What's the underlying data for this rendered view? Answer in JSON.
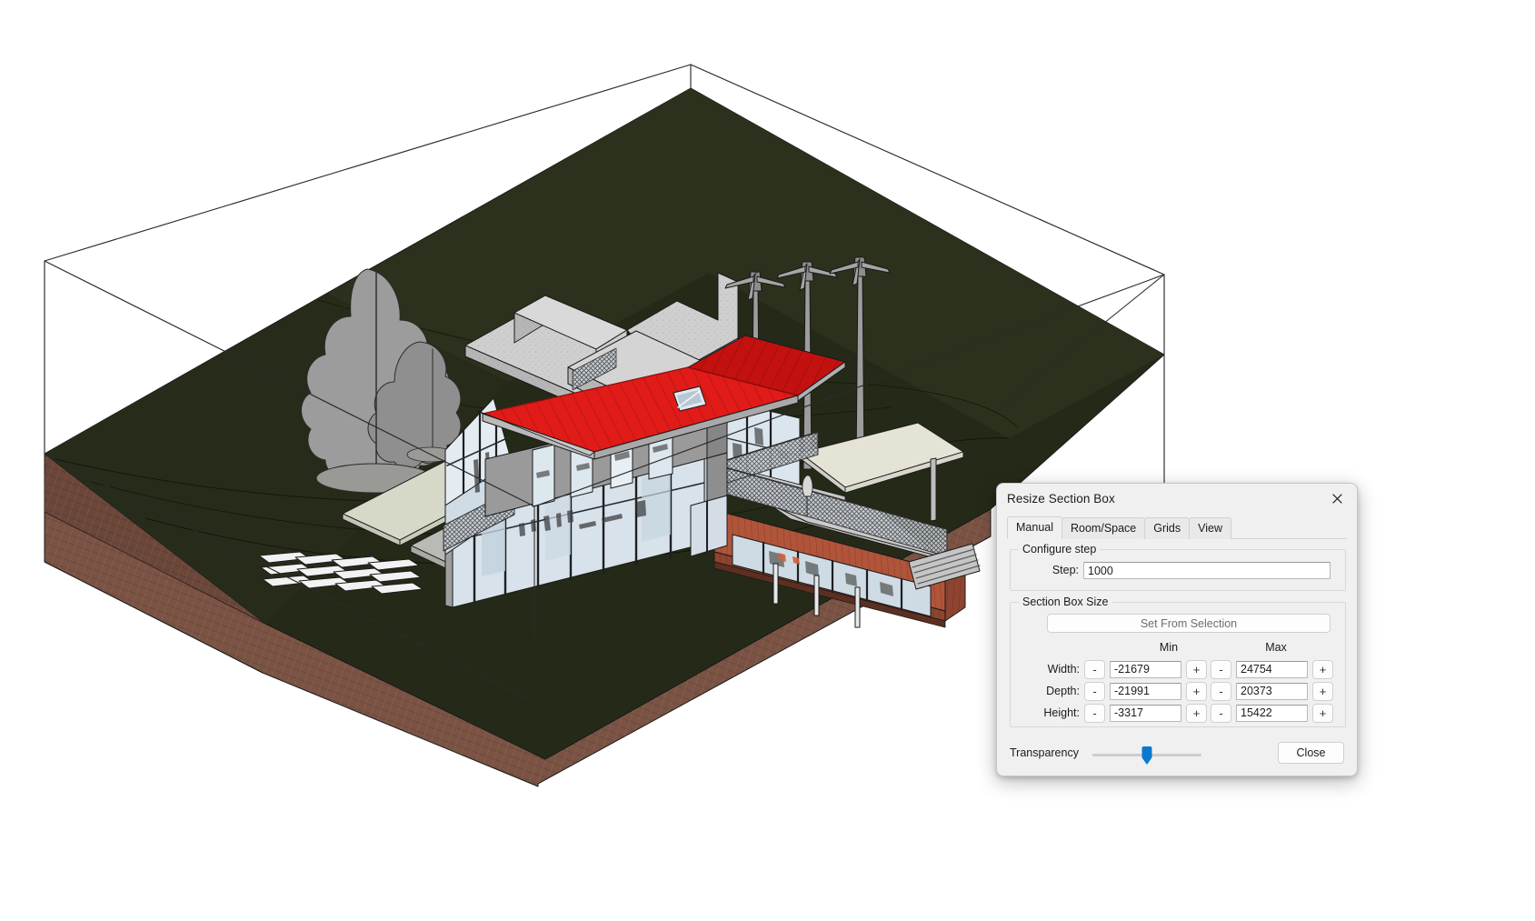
{
  "application": {
    "view_type": "3D Architectural Model View",
    "background_color": "#ffffff"
  },
  "viewport": {
    "name": "3d-model-viewport",
    "description": "Isometric 3D BIM model of a hillside house with red gabled roof, glass curtain walls, timber-clad lower wing, concrete retaining structures, terrain, trees, wind turbines and a section box wireframe",
    "section_box_visible": true,
    "model_colors": {
      "section_box_line": "#2b2b2b",
      "terrain_grass": "#252a18",
      "terrain_grass_light": "#30351f",
      "terrain_soil": "#7a5344",
      "terrain_soil_dark": "#6a473a",
      "roof_red": "#e01b18",
      "roof_red_shade": "#b51512",
      "wall_grey": "#9a9a9a",
      "wall_grey_dark": "#7d7d7d",
      "timber_orange": "#b0543a",
      "timber_orange_dark": "#8e4430",
      "concrete": "#cdcdcd",
      "concrete_shade": "#b4b4b4",
      "glass": "#dfe7ee",
      "glass_dark": "#aebdc9",
      "tree_grey": "#9c9c9c",
      "tree_grey_dark": "#8a8a8a",
      "paving": "#b9b9b5",
      "paving_light": "#d6d8c8",
      "outline": "#1a1a1a"
    },
    "elements": [
      "section-box-wireframe",
      "terrain-mass",
      "deciduous-tree",
      "concrete-retaining-walls",
      "main-house-red-roof",
      "skylight",
      "glass-curtain-wall",
      "timber-clad-wing",
      "roof-terrace",
      "balcony-railings",
      "wind-turbines",
      "parking-bays",
      "concrete-patio",
      "entry-path"
    ]
  },
  "dialog": {
    "title": "Resize Section Box",
    "close_icon": "close-icon",
    "tabs": [
      {
        "label": "Manual",
        "active": true
      },
      {
        "label": "Room/Space",
        "active": false
      },
      {
        "label": "Grids",
        "active": false
      },
      {
        "label": "View",
        "active": false
      }
    ],
    "configure_step": {
      "legend": "Configure step",
      "step_label": "Step:",
      "step_value": "1000",
      "step_placeholder": "1000"
    },
    "section_box_size": {
      "legend": "Section Box Size",
      "set_from_selection_label": "Set From Selection",
      "column_headers": {
        "min": "Min",
        "max": "Max"
      },
      "decrement_label": "-",
      "increment_label": "+",
      "rows": [
        {
          "label": "Width:",
          "min": "-21679",
          "max": "24754"
        },
        {
          "label": "Depth:",
          "min": "-21991",
          "max": "20373"
        },
        {
          "label": "Height:",
          "min": "-3317",
          "max": "15422"
        }
      ]
    },
    "footer": {
      "transparency_label": "Transparency",
      "transparency_value": 50,
      "transparency_thumb_color": "#0a79d0",
      "close_label": "Close"
    }
  }
}
